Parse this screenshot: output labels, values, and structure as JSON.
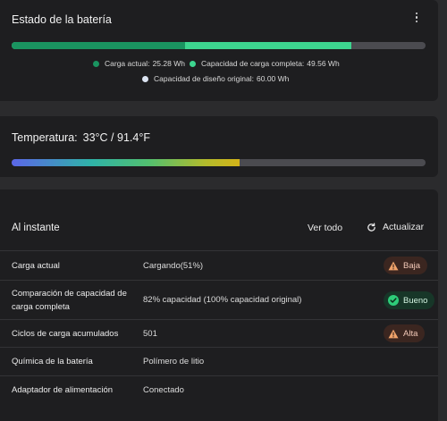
{
  "battery": {
    "title": "Estado de la batería",
    "bar": {
      "current_fraction": 0.42,
      "full_fraction": 0.821
    },
    "legend": [
      {
        "label": "Carga actual:",
        "value": "25.28 Wh",
        "color": "#1a9460"
      },
      {
        "label": "Capacidad de carga completa:",
        "value": "49.56 Wh",
        "color": "#3dd58f"
      },
      {
        "label": "Capacidad de diseño original:",
        "value": "60.00 Wh",
        "color": "#dce4f2"
      }
    ]
  },
  "temperature": {
    "label": "Temperatura:",
    "value": "33°C / 91.4°F",
    "fill_fraction": 0.551
  },
  "instant": {
    "title": "Al instante",
    "view_all": "Ver todo",
    "refresh": "Actualizar",
    "rows": [
      {
        "label": "Carga actual",
        "value": "Cargando(51%)",
        "badge": "Baja",
        "badge_kind": "warning"
      },
      {
        "label": "Comparación de capacidad de carga completa",
        "value": "82% capacidad (100% capacidad original)",
        "badge": "Bueno",
        "badge_kind": "good"
      },
      {
        "label": "Ciclos de carga acumulados",
        "value": "501",
        "badge": "Alta",
        "badge_kind": "warning"
      },
      {
        "label": "Química de la batería",
        "value": "Polímero de litio"
      },
      {
        "label": "Adaptador de alimentación",
        "value": "Conectado"
      }
    ]
  },
  "icons": {
    "menu": "kebab-menu-icon",
    "refresh": "refresh-icon",
    "warning": "warning-icon",
    "good": "check-circle-icon"
  }
}
